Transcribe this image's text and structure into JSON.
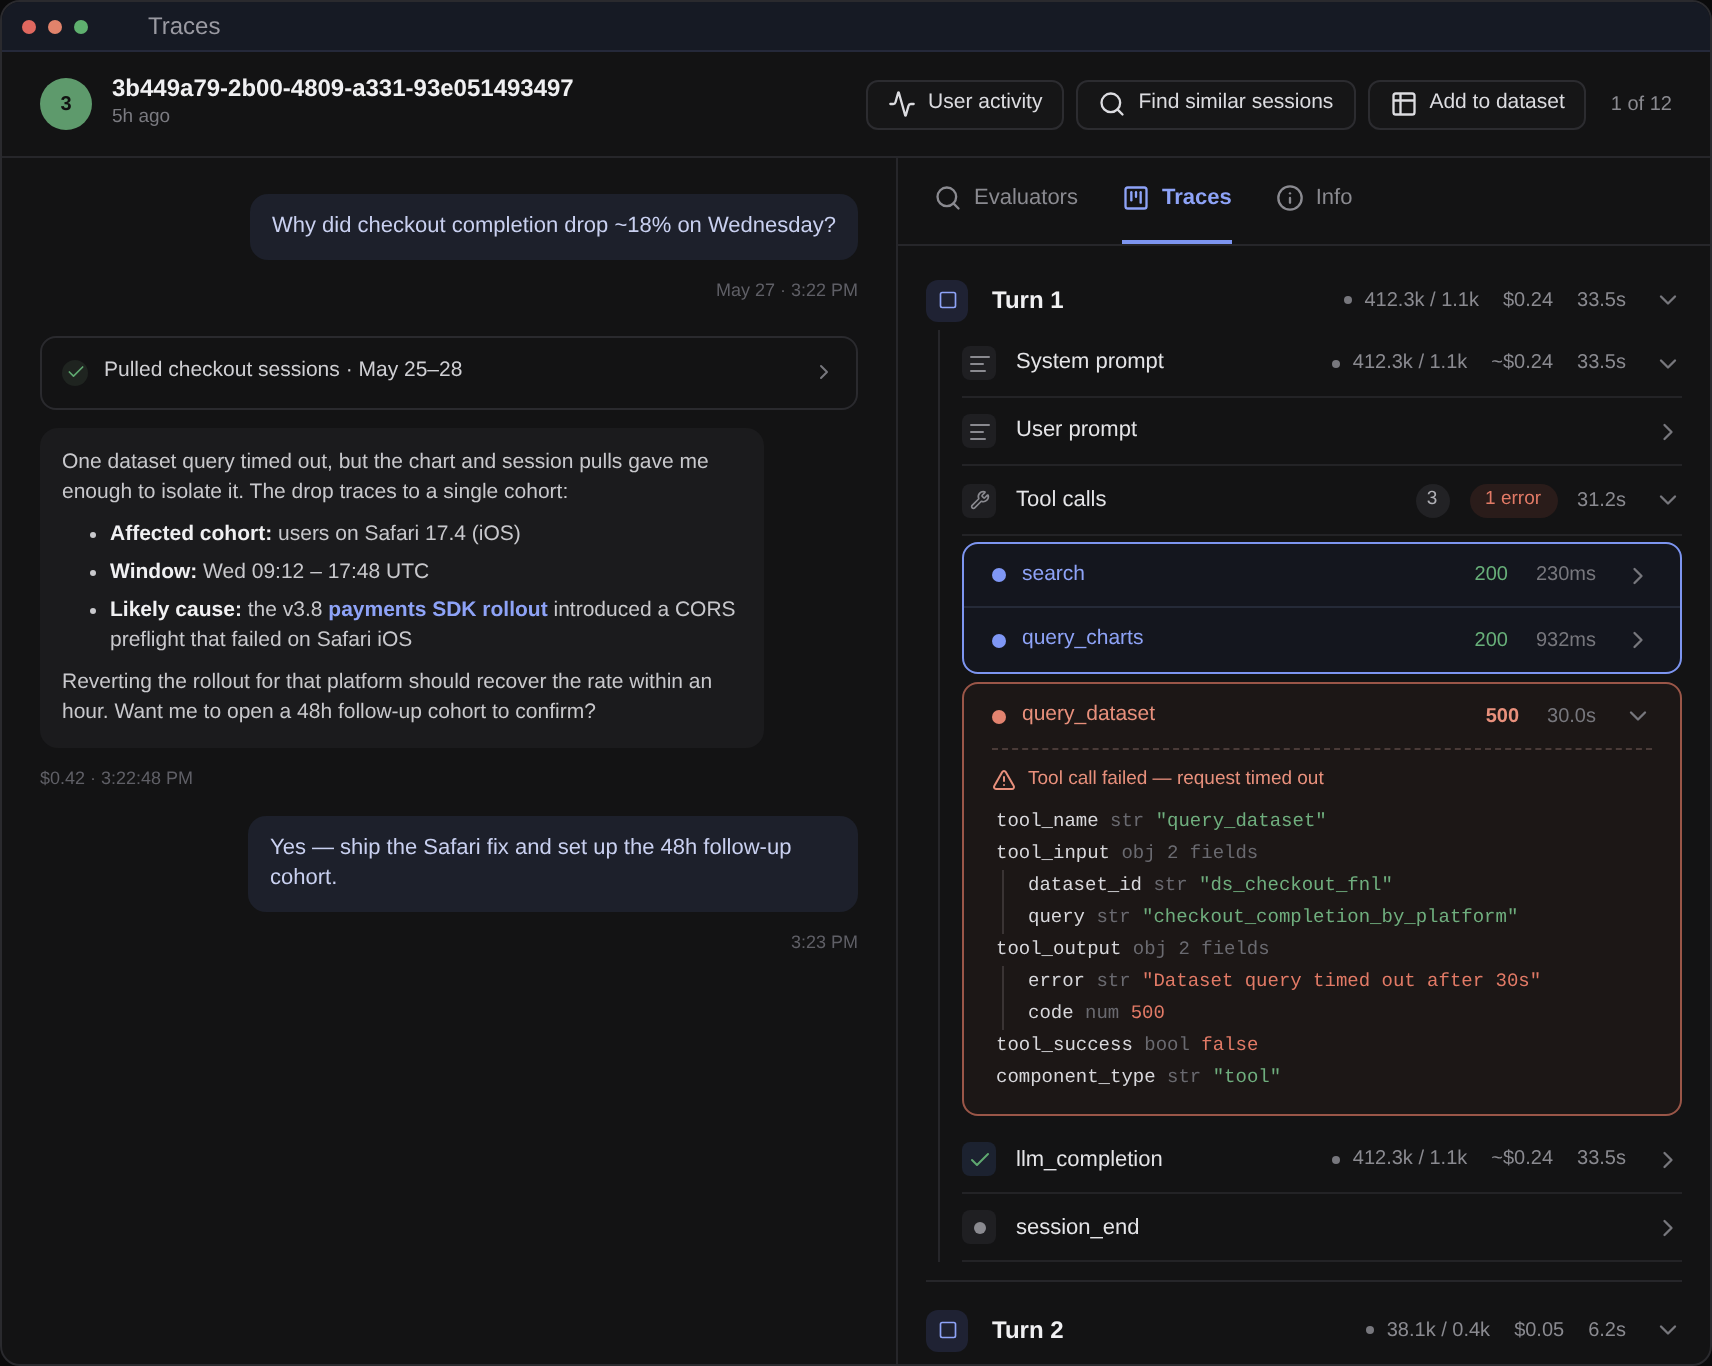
{
  "window": {
    "title": "Traces"
  },
  "header": {
    "avatar": "3",
    "session_id": "3b449a79-2b00-4809-a331-93e051493497",
    "time": "5h ago",
    "buttons": [
      "User activity",
      "Find similar sessions",
      "Add to dataset"
    ],
    "pager": "1 of 12"
  },
  "chat": [
    {
      "kind": "user",
      "text": "Why did checkout completion drop ~18% on Wednesday?",
      "time": "May 27 · 3:22 PM"
    },
    {
      "kind": "tool",
      "text": "Pulled checkout sessions · May 25–28",
      "done": true
    },
    {
      "kind": "assistant",
      "intro": "One dataset query timed out, but the chart and session pulls gave me enough to isolate it. The drop traces to a single cohort:",
      "bullets": [
        {
          "text": "**Affected cohort:** users on Safari 17.4 (iOS)"
        },
        {
          "text": "**Window:** Wed 09:12 – 17:48 UTC"
        },
        {
          "text": "**Likely cause:** the v3.8 ",
          "link": "payments SDK rollout",
          "after": " introduced a CORS preflight that failed on Safari iOS"
        }
      ],
      "outro": "Reverting the rollout for that platform should recover the rate within an hour. Want me to open a 48h follow-up cohort to confirm?",
      "meta": "$0.42 · 3:22:48 PM"
    },
    {
      "kind": "user",
      "text": "Yes — ship the Safari fix and set up the 48h follow-up cohort.",
      "time": "3:23 PM"
    }
  ],
  "tabs": [
    {
      "label": "Evaluators",
      "selected": false
    },
    {
      "label": "Traces",
      "selected": true
    },
    {
      "label": "Info",
      "selected": false
    }
  ],
  "turns": [
    {
      "title": "Turn 1",
      "expanded": true,
      "tokens": "412.3k / 1.1k",
      "cost": "$0.24",
      "duration": "33.5s",
      "steps": [
        {
          "kind": "prompt",
          "label": "System prompt",
          "tokens": "412.3k / 1.1k",
          "cost": "~$0.24",
          "duration": "33.5s",
          "expanded": true
        },
        {
          "kind": "prompt",
          "label": "User prompt",
          "expanded": false
        },
        {
          "kind": "tools",
          "label": "Tool calls",
          "count": "3",
          "errors": "1 error",
          "duration": "31.2s",
          "expanded": true,
          "groups": [
            {
              "selected": true,
              "failed": false,
              "calls": [
                {
                  "name": "search",
                  "status": "200",
                  "duration": "230ms",
                  "expanded": false
                },
                {
                  "name": "query_charts",
                  "status": "200",
                  "duration": "932ms",
                  "expanded": false
                }
              ]
            },
            {
              "selected": false,
              "failed": true,
              "calls": [
                {
                  "name": "query_dataset",
                  "status": "500",
                  "duration": "30.0s",
                  "expanded": true,
                  "error": "Tool call failed — request timed out",
                  "fields": [
                    {
                      "key": "tool_name",
                      "type": "str",
                      "value": "\"query_dataset\"",
                      "error": false
                    },
                    {
                      "key": "tool_input",
                      "type": "obj 2 fields",
                      "children": [
                        {
                          "key": "dataset_id",
                          "type": "str",
                          "value": "\"ds_checkout_fnl\"",
                          "error": false
                        },
                        {
                          "key": "query",
                          "type": "str",
                          "value": "\"checkout_completion_by_platform\"",
                          "error": false
                        }
                      ]
                    },
                    {
                      "key": "tool_output",
                      "type": "obj 2 fields",
                      "children": [
                        {
                          "key": "error",
                          "type": "str",
                          "value": "\"Dataset query timed out after 30s\"",
                          "error": true
                        },
                        {
                          "key": "code",
                          "type": "num",
                          "value": "500",
                          "error": true
                        }
                      ]
                    },
                    {
                      "key": "tool_success",
                      "type": "bool",
                      "value": "false",
                      "error": true
                    },
                    {
                      "key": "component_type",
                      "type": "str",
                      "value": "\"tool\"",
                      "error": false
                    }
                  ]
                }
              ]
            }
          ]
        },
        {
          "kind": "completion",
          "label": "llm_completion",
          "tokens": "412.3k / 1.1k",
          "cost": "~$0.24",
          "duration": "33.5s",
          "expanded": false
        },
        {
          "kind": "end",
          "label": "session_end",
          "expanded": false
        }
      ]
    },
    {
      "title": "Turn 2",
      "expanded": true,
      "tokens": "38.1k / 0.4k",
      "cost": "$0.05",
      "duration": "6.2s"
    }
  ]
}
